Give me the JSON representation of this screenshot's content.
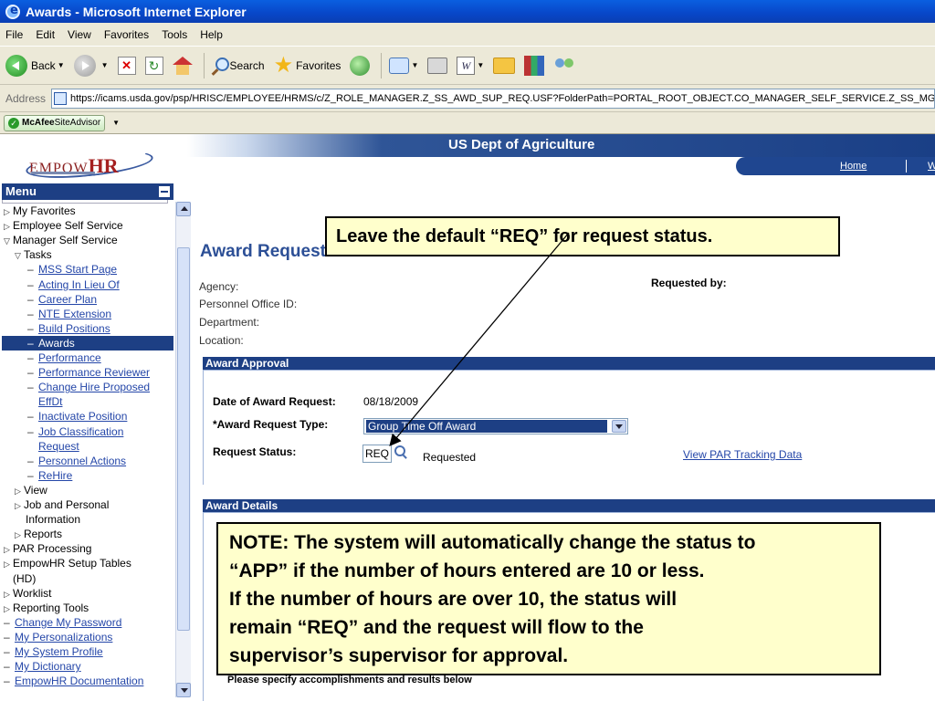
{
  "window": {
    "title": "Awards - Microsoft Internet Explorer"
  },
  "menubar": [
    "File",
    "Edit",
    "View",
    "Favorites",
    "Tools",
    "Help"
  ],
  "toolbar": {
    "back": "Back",
    "search": "Search",
    "favorites": "Favorites"
  },
  "address": {
    "label": "Address",
    "url": "https://icams.usda.gov/psp/HRISC/EMPLOYEE/HRMS/c/Z_ROLE_MANAGER.Z_SS_AWD_SUP_REQ.USF?FolderPath=PORTAL_ROOT_OBJECT.CO_MANAGER_SELF_SERVICE.Z_SS_MGR_"
  },
  "links": {
    "mcafee_bold": "McAfee",
    "mcafee_rest": " SiteAdvisor"
  },
  "header": {
    "logo_a": "EMPOW",
    "logo_b": "HR",
    "dept": "US Dept of Agriculture",
    "home": "Home",
    "more": "W"
  },
  "menu": {
    "title": "Menu",
    "items": [
      "My Favorites",
      "Employee Self Service",
      "Manager Self Service",
      "Tasks",
      "MSS Start Page",
      "Acting In Lieu Of",
      "Career Plan",
      "NTE Extension",
      "Build Positions",
      "Awards",
      "Performance",
      "Performance Reviewer",
      "Change Hire Proposed",
      "EffDt",
      "Inactivate Position",
      "Job Classification",
      "Request",
      "Personnel Actions",
      "ReHire",
      "View",
      "Job and Personal",
      "Information",
      "Reports",
      "PAR Processing",
      "EmpowHR Setup Tables",
      "(HD)",
      "Worklist",
      "Reporting Tools",
      "Change My Password",
      "My Personalizations",
      "My System Profile",
      "My Dictionary",
      "EmpowHR Documentation"
    ]
  },
  "main": {
    "title": "Award Request for",
    "agency_label": "Agency:",
    "poid_label": "Personnel Office ID:",
    "dept_label": "Department:",
    "location_label": "Location:",
    "requested_by_label": "Requested by:",
    "approval_section": "Award Approval",
    "date_label": "Date of Award Request:",
    "date_value": "08/18/2009",
    "type_label": "*Award Request Type:",
    "type_value": "Group Time Off Award",
    "status_label": "Request Status:",
    "status_value": "REQ",
    "status_desc": "Requested",
    "par_link": "View PAR Tracking Data",
    "details_section": "Award Details",
    "accomplishments": "Please specify accomplishments and results below"
  },
  "callouts": {
    "top": "Leave the default “REQ” for request status.",
    "note": [
      "NOTE: The system will automatically change the status to",
      "“APP” if the number of hours entered are 10 or less.",
      "If the number of hours are over 10, the status will",
      "remain “REQ” and the request will flow to the",
      "supervisor’s supervisor for approval."
    ]
  }
}
